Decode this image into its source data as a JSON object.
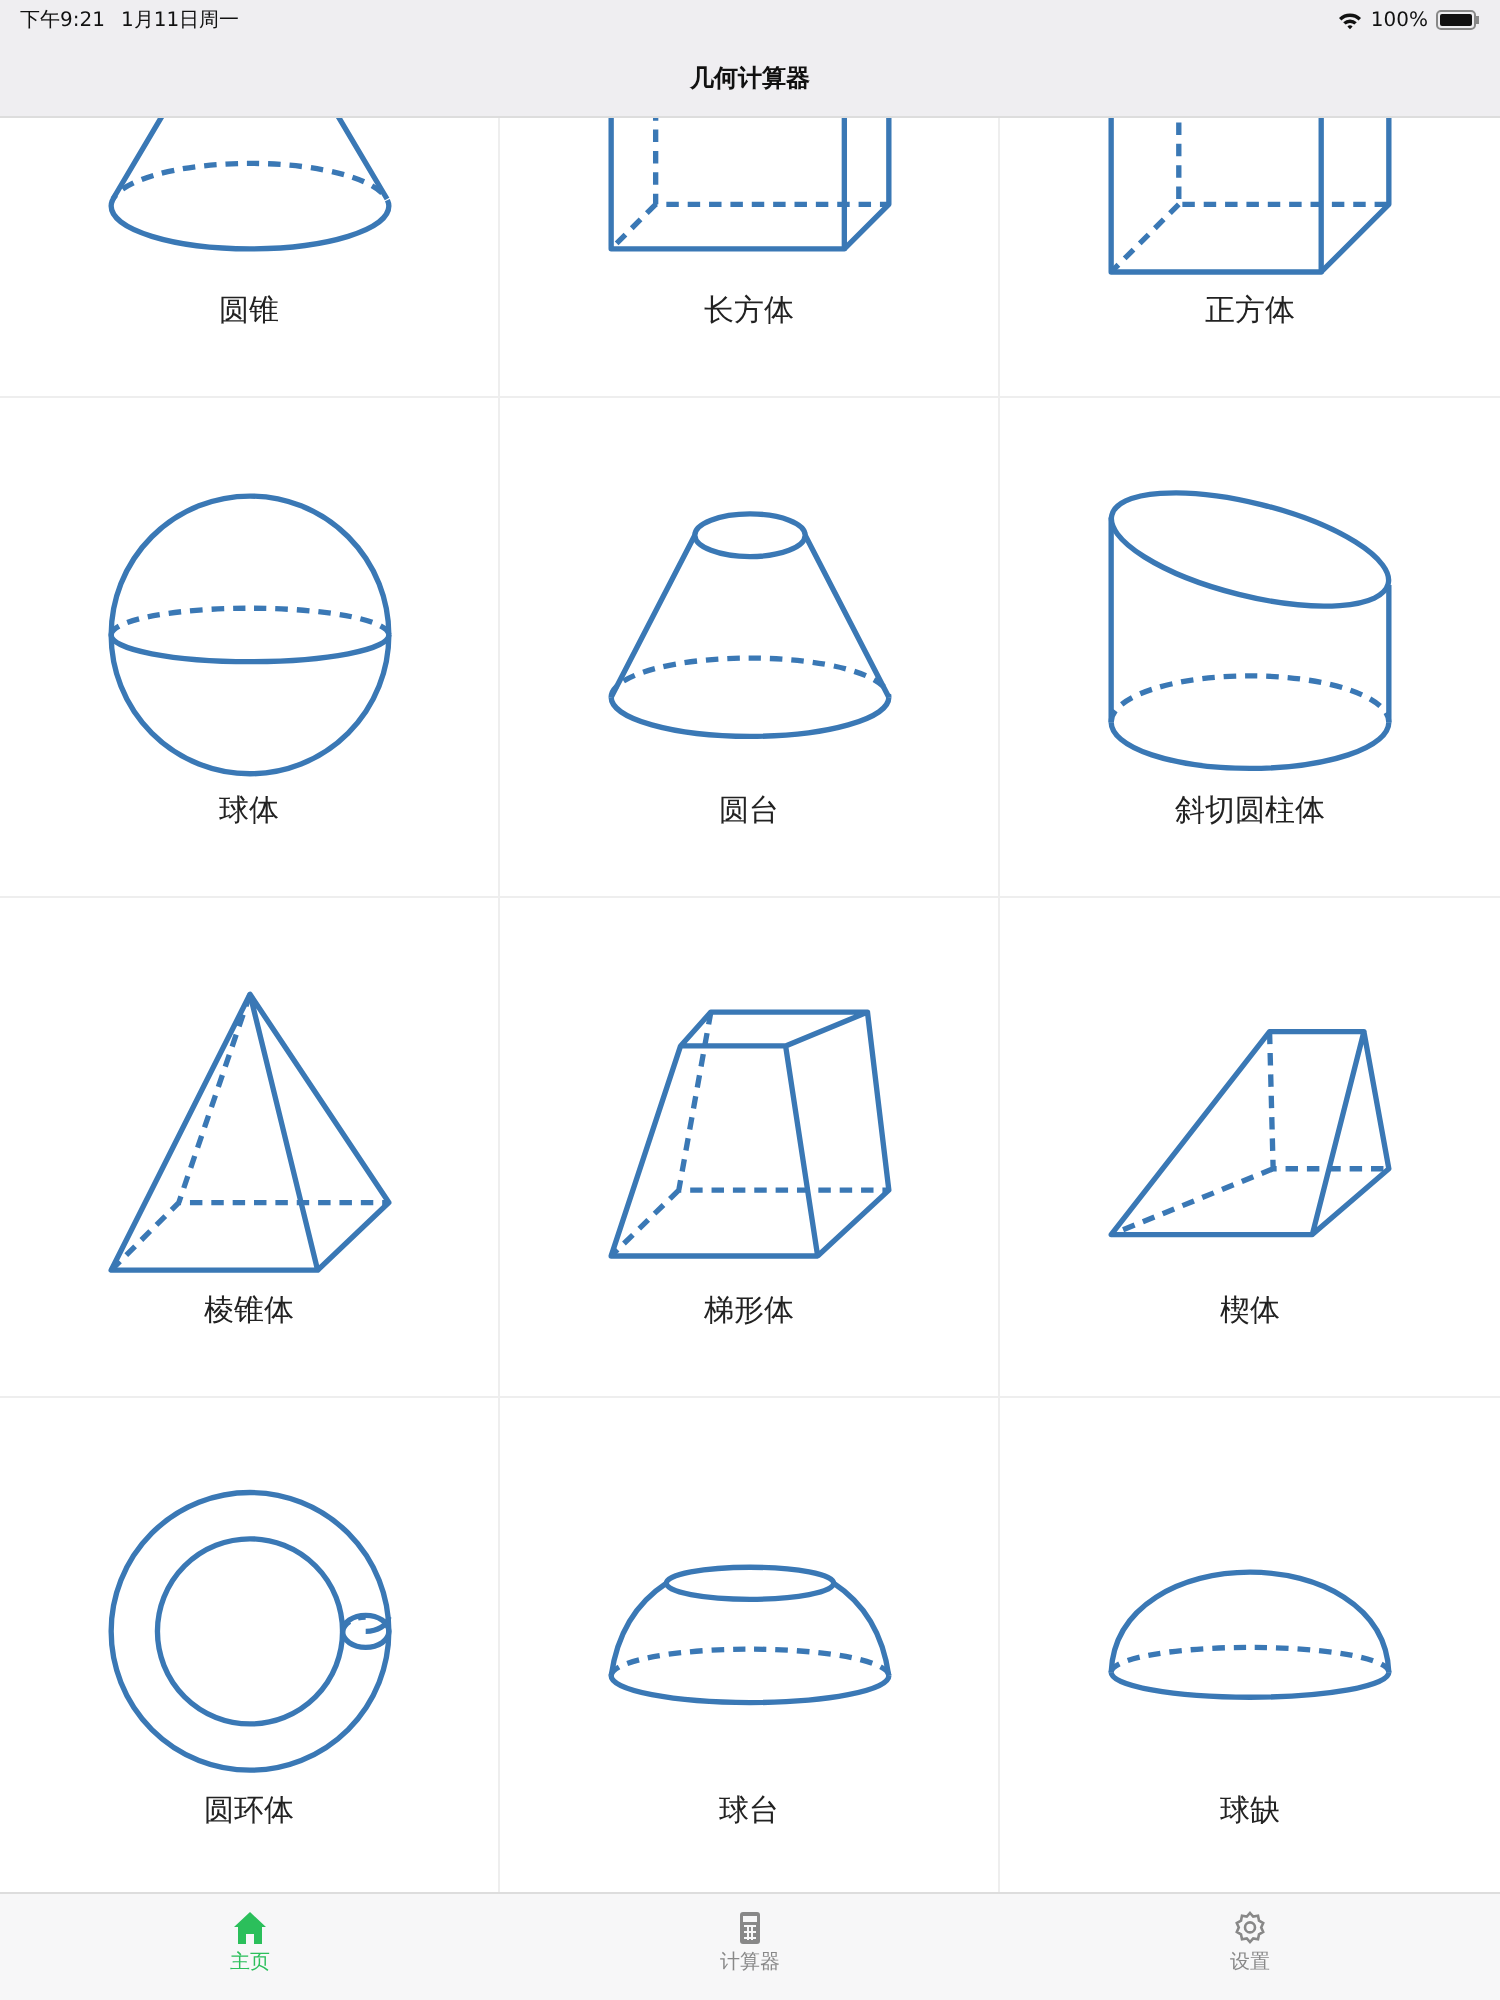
{
  "status_bar": {
    "time": "下午9:21",
    "date": "1月11日周一",
    "battery": "100%"
  },
  "nav_bar": {
    "title": "几何计算器"
  },
  "shapes": [
    {
      "kind": "cone",
      "label": "圆锥"
    },
    {
      "kind": "cuboid",
      "label": "长方体"
    },
    {
      "kind": "cube",
      "label": "正方体"
    },
    {
      "kind": "sphere",
      "label": "球体"
    },
    {
      "kind": "frustum",
      "label": "圆台"
    },
    {
      "kind": "oblique-cylinder",
      "label": "斜切圆柱体"
    },
    {
      "kind": "pyramid",
      "label": "棱锥体"
    },
    {
      "kind": "prismoid",
      "label": "梯形体"
    },
    {
      "kind": "wedge",
      "label": "楔体"
    },
    {
      "kind": "torus",
      "label": "圆环体"
    },
    {
      "kind": "spherical-segment",
      "label": "球台"
    },
    {
      "kind": "spherical-cap",
      "label": "球缺"
    }
  ],
  "tab_bar": [
    {
      "kind": "home",
      "label": "主页",
      "selected": true
    },
    {
      "kind": "calculator",
      "label": "计算器",
      "selected": false
    },
    {
      "kind": "settings",
      "label": "设置",
      "selected": false
    }
  ]
}
